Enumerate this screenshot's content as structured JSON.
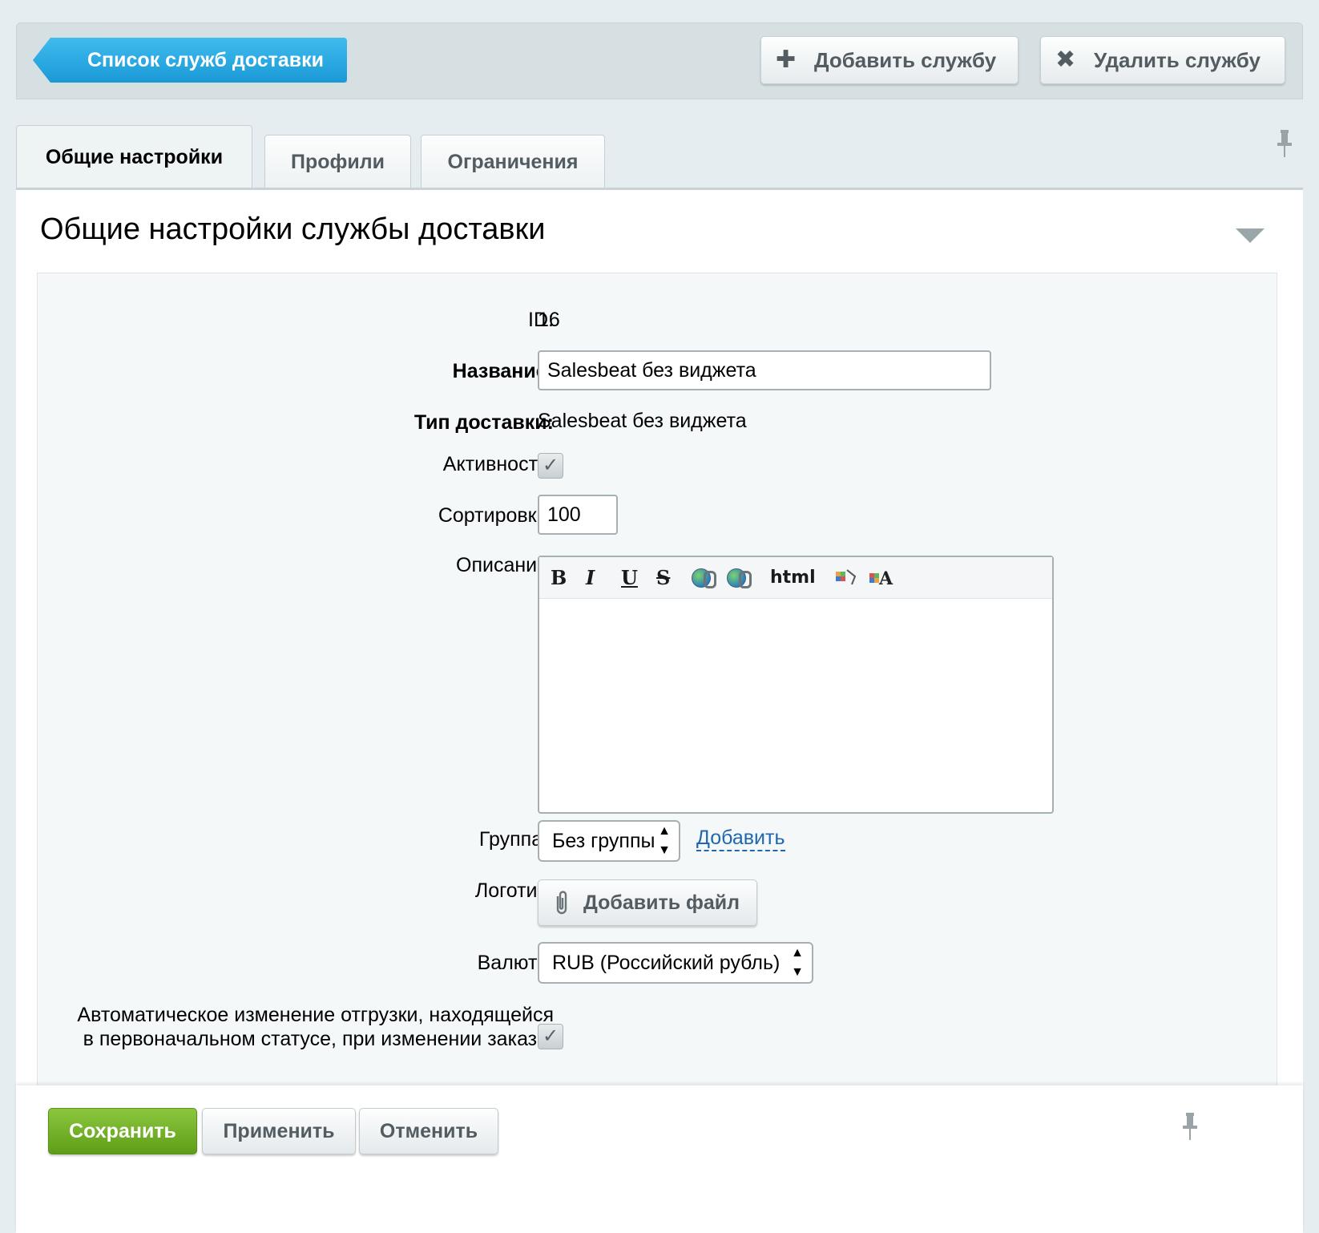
{
  "toolbar": {
    "back_label": "Список служб доставки",
    "add_label": "Добавить службу",
    "delete_label": "Удалить службу",
    "add_icon": "plus-icon",
    "delete_icon": "x-icon"
  },
  "tabs": [
    {
      "label": "Общие настройки",
      "active": true
    },
    {
      "label": "Профили",
      "active": false
    },
    {
      "label": "Ограничения",
      "active": false
    }
  ],
  "section": {
    "title": "Общие настройки службы доставки"
  },
  "form": {
    "id_label": "ID:",
    "id_value": "16",
    "name_label": "Название:",
    "name_value": "Salesbeat без виджета",
    "type_label": "Тип доставки:",
    "type_value": "Salesbeat без виджета",
    "active_label": "Активность:",
    "active_checked": true,
    "sort_label": "Сортировка:",
    "sort_value": "100",
    "description_label": "Описание:",
    "description_value": "",
    "editor_toolbar": {
      "bold": "B",
      "italic": "I",
      "underline": "U",
      "strike": "S",
      "html": "html"
    },
    "group_label": "Группа :",
    "group_value": "Без группы",
    "group_add_link": "Добавить",
    "logo_label": "Логотип:",
    "logo_button": "Добавить файл",
    "currency_label": "Валюта:",
    "currency_value": "RUB (Российский рубль)",
    "auto_change_label": "Автоматическое изменение отгрузки, находящейся в первоначальном статусе, при изменении заказа:",
    "auto_change_checked": true
  },
  "footer": {
    "save_label": "Сохранить",
    "apply_label": "Применить",
    "cancel_label": "Отменить"
  },
  "colors": {
    "accent_blue": "#1a99d6",
    "save_green": "#6aab1f",
    "link_blue": "#2067b0"
  }
}
